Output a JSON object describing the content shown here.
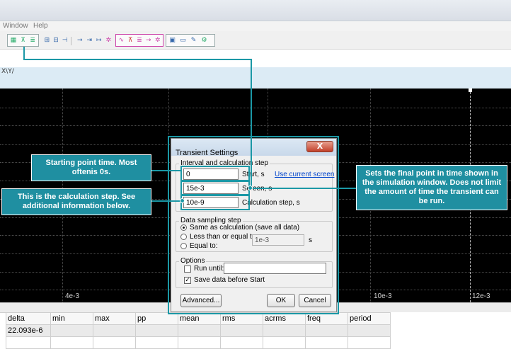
{
  "menu": {
    "window": "Window",
    "help": "Help"
  },
  "toolbar": {
    "icons": [
      "grid-icon",
      "transient-icon",
      "list-icon",
      "table-icon",
      "export-icon",
      "cursor-icon",
      "marker-icon",
      "probe-icon",
      "wave-icon",
      "settings-icon"
    ]
  },
  "tabs": {
    "xy": "X\\Y/"
  },
  "plot": {
    "tick_labels": [
      "4e-3",
      "10e-3",
      "12e-3"
    ],
    "background": "#000000",
    "grid_color": "#4e4e4e"
  },
  "measurements": {
    "headers": [
      "delta",
      "min",
      "max",
      "pp",
      "mean",
      "rms",
      "acrms",
      "freq",
      "period"
    ],
    "row1": [
      "22.093e-6",
      "",
      "",
      "",
      "",
      "",
      "",
      "",
      ""
    ]
  },
  "dialog": {
    "title": "Transient Settings",
    "close": "X",
    "interval_group": "Interval and calculation step",
    "start_value": "0",
    "start_label": "Start, s",
    "use_current_screen": "Use current screen",
    "screen_value": "15e-3",
    "screen_label": "Screen, s",
    "step_value": "10e-9",
    "step_label": "Calculation step, s",
    "sampling_group": "Data sampling step",
    "opt_same": "Same as calculation (save all data)",
    "opt_less": "Less than or equal to:",
    "opt_equal": "Equal to:",
    "sampling_value": "1e-3",
    "sampling_unit": "s",
    "options_group": "Options",
    "run_until": "Run until:",
    "save_data": "Save data before Start",
    "advanced": "Advanced...",
    "ok": "OK",
    "cancel": "Cancel"
  },
  "callouts": {
    "start": "Starting point time. Most oftenis 0s.",
    "step": "This is the calculation step. See additional information below.",
    "screen": "Sets the final point in time shown in the simulation window. Does not limit the amount of time the transient can be run."
  },
  "colors": {
    "accent": "#1b98a6",
    "callout_bg": "#1f8fa1"
  }
}
